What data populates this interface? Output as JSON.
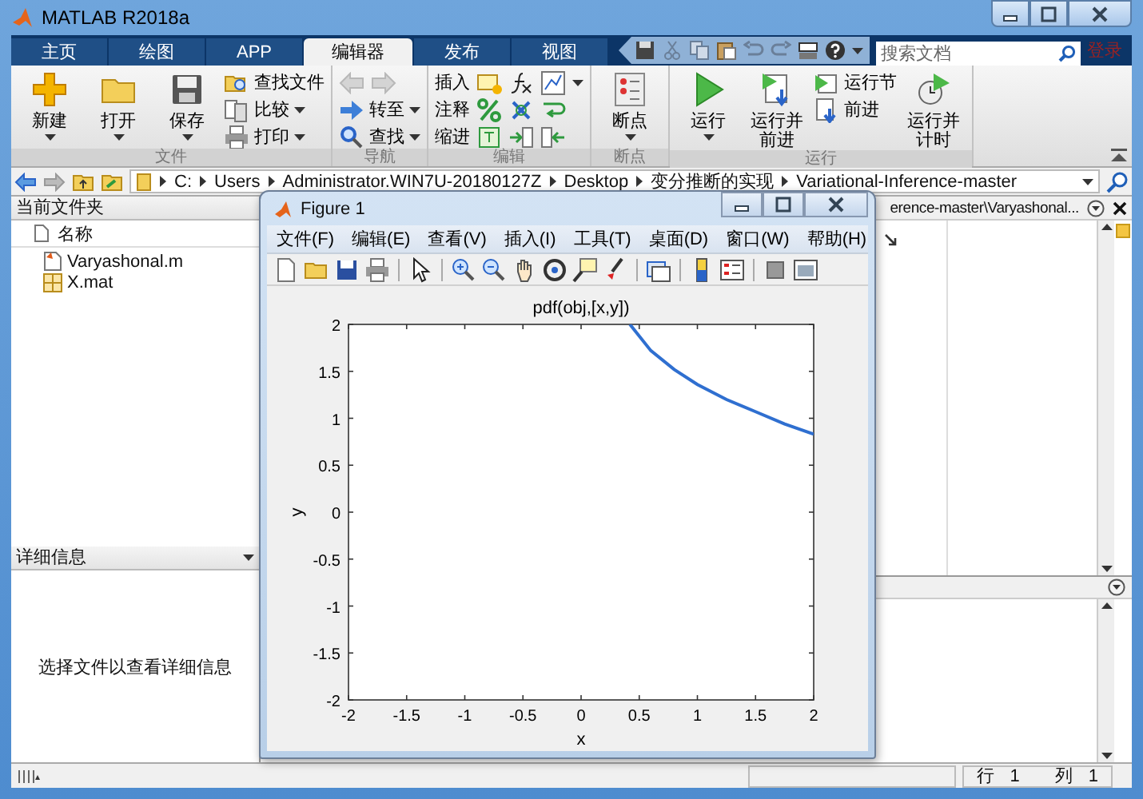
{
  "window": {
    "title": "MATLAB R2018a"
  },
  "tabs": [
    {
      "label": "主页",
      "selected": false
    },
    {
      "label": "绘图",
      "selected": false
    },
    {
      "label": "APP",
      "selected": false
    },
    {
      "label": "编辑器",
      "selected": true
    },
    {
      "label": "发布",
      "selected": false
    },
    {
      "label": "视图",
      "selected": false
    }
  ],
  "search": {
    "placeholder": "搜索文档"
  },
  "login": "登录",
  "toolstrip": [
    {
      "title": "文件",
      "items": [
        {
          "kind": "big",
          "label": "新建",
          "dropdown": true
        },
        {
          "kind": "big",
          "label": "打开",
          "dropdown": true
        },
        {
          "kind": "big",
          "label": "保存",
          "dropdown": true
        },
        {
          "kind": "small",
          "label": "查找文件",
          "dropdown": false
        },
        {
          "kind": "small",
          "label": "比较",
          "dropdown": true
        },
        {
          "kind": "small",
          "label": "打印",
          "dropdown": true
        }
      ]
    },
    {
      "title": "导航",
      "items": [
        {
          "kind": "arrows"
        },
        {
          "kind": "small",
          "label": "转至",
          "dropdown": true
        },
        {
          "kind": "small",
          "label": "查找",
          "dropdown": true
        }
      ]
    },
    {
      "title": "编辑",
      "items": [
        {
          "kind": "edit-row",
          "label": "插入",
          "dropdown": true
        },
        {
          "kind": "edit-row",
          "label": "注释",
          "dropdown": false
        },
        {
          "kind": "edit-row",
          "label": "缩进",
          "dropdown": false
        }
      ]
    },
    {
      "title": "断点",
      "items": [
        {
          "kind": "big",
          "label": "断点",
          "dropdown": true
        }
      ]
    },
    {
      "title": "运行",
      "items": [
        {
          "kind": "big",
          "label": "运行",
          "dropdown": true
        },
        {
          "kind": "big",
          "label": "运行并前进",
          "dropdown": false
        },
        {
          "kind": "small",
          "label": "运行节",
          "dropdown": false
        },
        {
          "kind": "small",
          "label": "前进",
          "dropdown": false
        },
        {
          "kind": "big",
          "label": "运行并计时",
          "dropdown": false
        }
      ]
    }
  ],
  "address": [
    "C:",
    "Users",
    "Administrator.WIN7U-20180127Z",
    "Desktop",
    "变分推断的实现",
    "Variational-Inference-master"
  ],
  "current_folder": {
    "title": "当前文件夹",
    "column": "名称",
    "files": [
      {
        "name": "Varyashonal.m",
        "kind": "script"
      },
      {
        "name": "X.mat",
        "kind": "data"
      }
    ]
  },
  "details": {
    "title": "详细信息",
    "message": "选择文件以查看详细信息"
  },
  "editor": {
    "tab": "erence-master\\Varyashonal..."
  },
  "status_bar": {
    "row_label": "行",
    "row": "1",
    "col_label": "列",
    "col": "1"
  },
  "figure": {
    "title": "Figure 1",
    "menu": [
      "文件(F)",
      "编辑(E)",
      "查看(V)",
      "插入(I)",
      "工具(T)",
      "桌面(D)",
      "窗口(W)",
      "帮助(H)"
    ],
    "chart_data": {
      "type": "line",
      "title": "pdf(obj,[x,y])",
      "xlabel": "x",
      "ylabel": "y",
      "xlim": [
        -2,
        2
      ],
      "ylim": [
        -2,
        2
      ],
      "xticks": [
        -2,
        -1.5,
        -1,
        -0.5,
        0,
        0.5,
        1,
        1.5,
        2
      ],
      "yticks": [
        -2,
        -1.5,
        -1,
        -0.5,
        0,
        0.5,
        1,
        1.5,
        2
      ],
      "x": [
        0.42,
        0.6,
        0.8,
        1.0,
        1.25,
        1.5,
        1.75,
        2
      ],
      "series": [
        {
          "color": "#2f6fd0",
          "values": [
            2,
            1.72,
            1.52,
            1.36,
            1.2,
            1.07,
            0.94,
            0.83
          ]
        }
      ]
    }
  }
}
